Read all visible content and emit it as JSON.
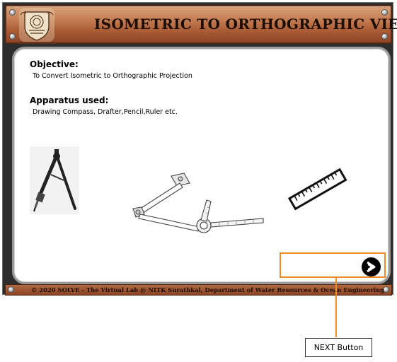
{
  "header": {
    "title": "ISOMETRIC TO ORTHOGRAPHIC VIEW"
  },
  "objective": {
    "heading": "Objective:",
    "text": "To Convert Isometric to Orthographic Projection"
  },
  "apparatus": {
    "heading": "Apparatus used:",
    "text": "Drawing Compass, Drafter,Pencil,Ruler etc."
  },
  "images": [
    {
      "name": "drawing-compass-icon"
    },
    {
      "name": "drafter-icon"
    },
    {
      "name": "ruler-icon"
    }
  ],
  "footer": {
    "text": "© 2020 SOLVE - The Virtual Lab @ NITK Surathkal, Department of Water Resources & Ocean Engineering"
  },
  "annotation": {
    "label": "NEXT Button",
    "color": "#f08a2e"
  },
  "colors": {
    "title_bar": "#b8663c",
    "frame": "#2d2d2d"
  }
}
